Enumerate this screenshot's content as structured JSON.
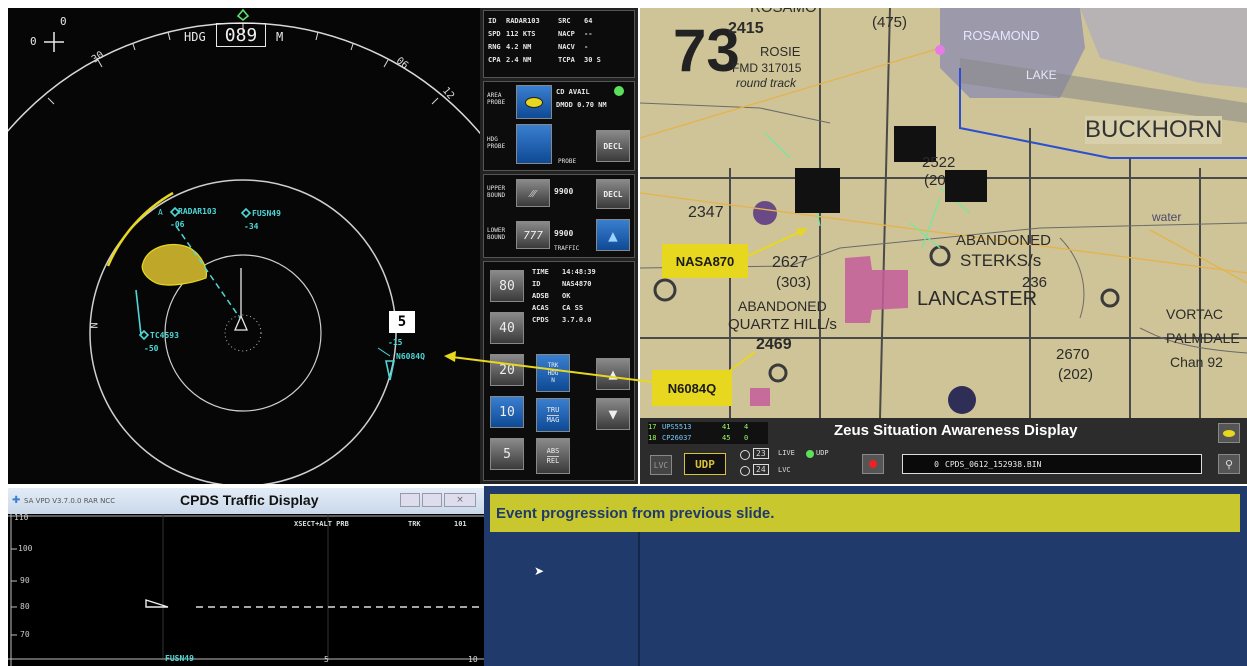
{
  "radar": {
    "north_value": "0",
    "compass_value": "0",
    "hdg_label": "HDG",
    "heading": "089",
    "hdg_unit": "M",
    "tick_labels": [
      "30",
      "06",
      "12"
    ],
    "range_box": "5",
    "north_marker": "N",
    "traffic": [
      {
        "id": "RADAR103",
        "alt": "-06",
        "prefix": "A"
      },
      {
        "id": "FUSN49",
        "alt": "-34"
      },
      {
        "id": "TC4593",
        "alt": "-50"
      },
      {
        "id": "N6084Q",
        "alt": "-15"
      }
    ]
  },
  "info_box": {
    "row1": [
      "ID",
      "RADAR103",
      "SRC",
      "64"
    ],
    "row2": [
      "SPD",
      "112 KTS",
      "NACP",
      "--"
    ],
    "row3": [
      "RNG",
      "4.2 NM",
      "NACV",
      "-"
    ],
    "row4": [
      "CPA",
      "2.4 NM",
      "TCPA",
      "30 S"
    ]
  },
  "controls": {
    "area_probe_label": "AREA PROBE",
    "cd_avail": "CD AVAIL",
    "dmod": "DMOD 0.70 NM",
    "hdg_probe_label": "HDG PROBE",
    "probe_label": "PROBE",
    "decl1": "DECL",
    "upper_bound_label": "UPPER BOUND",
    "upper_value": "9900",
    "decl2": "DECL",
    "lower_bound_label": "LOWER BOUND",
    "lower_value": "9900",
    "traffic_label": "TRAFFIC",
    "ranges": [
      "80",
      "40",
      "20",
      "10",
      "5"
    ],
    "selected_range": "10",
    "trk_hdg": [
      "TRK",
      "HDG",
      "N"
    ],
    "tru_mag": [
      "TRU",
      "MAG"
    ],
    "abs_rel": [
      "ABS",
      "REL"
    ]
  },
  "status_box": {
    "time_label": "TIME",
    "time_value": "14:48:39",
    "id_label": "ID",
    "id_value": "NAS4870",
    "adsb_label": "ADSB",
    "adsb_value": "OK",
    "acas_label": "ACAS",
    "acas_value": "CA SS",
    "cpds_label": "CPDS",
    "cpds_value": "3.7.0.0"
  },
  "map": {
    "sector_number": "73",
    "labels": [
      "2415",
      "ROSIE",
      "FMD 317015",
      "round track",
      "(475)",
      "ROSAMOND",
      "LAKE",
      "BUCKHORN",
      "2522",
      "(20",
      "2347",
      "ABANDONED",
      "STERKS/s",
      "2627",
      "(303)",
      "LANCASTER",
      "236",
      "water",
      "ABANDONED",
      "QUARTZ HILL/s",
      "2469",
      "VORTAC",
      "PALMDALE",
      "Chan 92",
      "2670",
      "(202)",
      "ROSAMO"
    ]
  },
  "callouts": {
    "nasa": "NASA870",
    "n6084q": "N6084Q"
  },
  "zeus": {
    "title": "Zeus Situation Awareness Display",
    "rows": [
      [
        "17",
        "UPS5513",
        "41",
        "4"
      ],
      [
        "18",
        "CP26037",
        "45",
        "0"
      ]
    ],
    "lvc_btn": "LVC",
    "udp_btn": "UDP",
    "opt1_num": "23",
    "opt1_label": "LIVE",
    "udp_radio": "UDP",
    "opt2_num": "24",
    "opt2_label": "LVC",
    "file_num": "0",
    "file_name": "CPDS_0612_152938.BIN"
  },
  "vpd": {
    "window_title": "SA VPD V3.7.0.0 RAR NCC",
    "heading": "CPDS Traffic Display",
    "header_text": "XSECT+ALT PRB",
    "trk_label": "TRK",
    "trk_value": "101",
    "y_ticks": [
      "110",
      "100",
      "90",
      "80",
      "70"
    ],
    "x_label": "FUSN49",
    "x_ticks": [
      "5",
      "10"
    ]
  },
  "event": {
    "text": "Event progression from previous slide."
  },
  "colors": {
    "cyan": "#4fd6d6",
    "yellow": "#e7d81f",
    "probe_fill": "#bfa72a",
    "event_bg": "#1f3a6b",
    "map_bg": "#cfc497"
  }
}
